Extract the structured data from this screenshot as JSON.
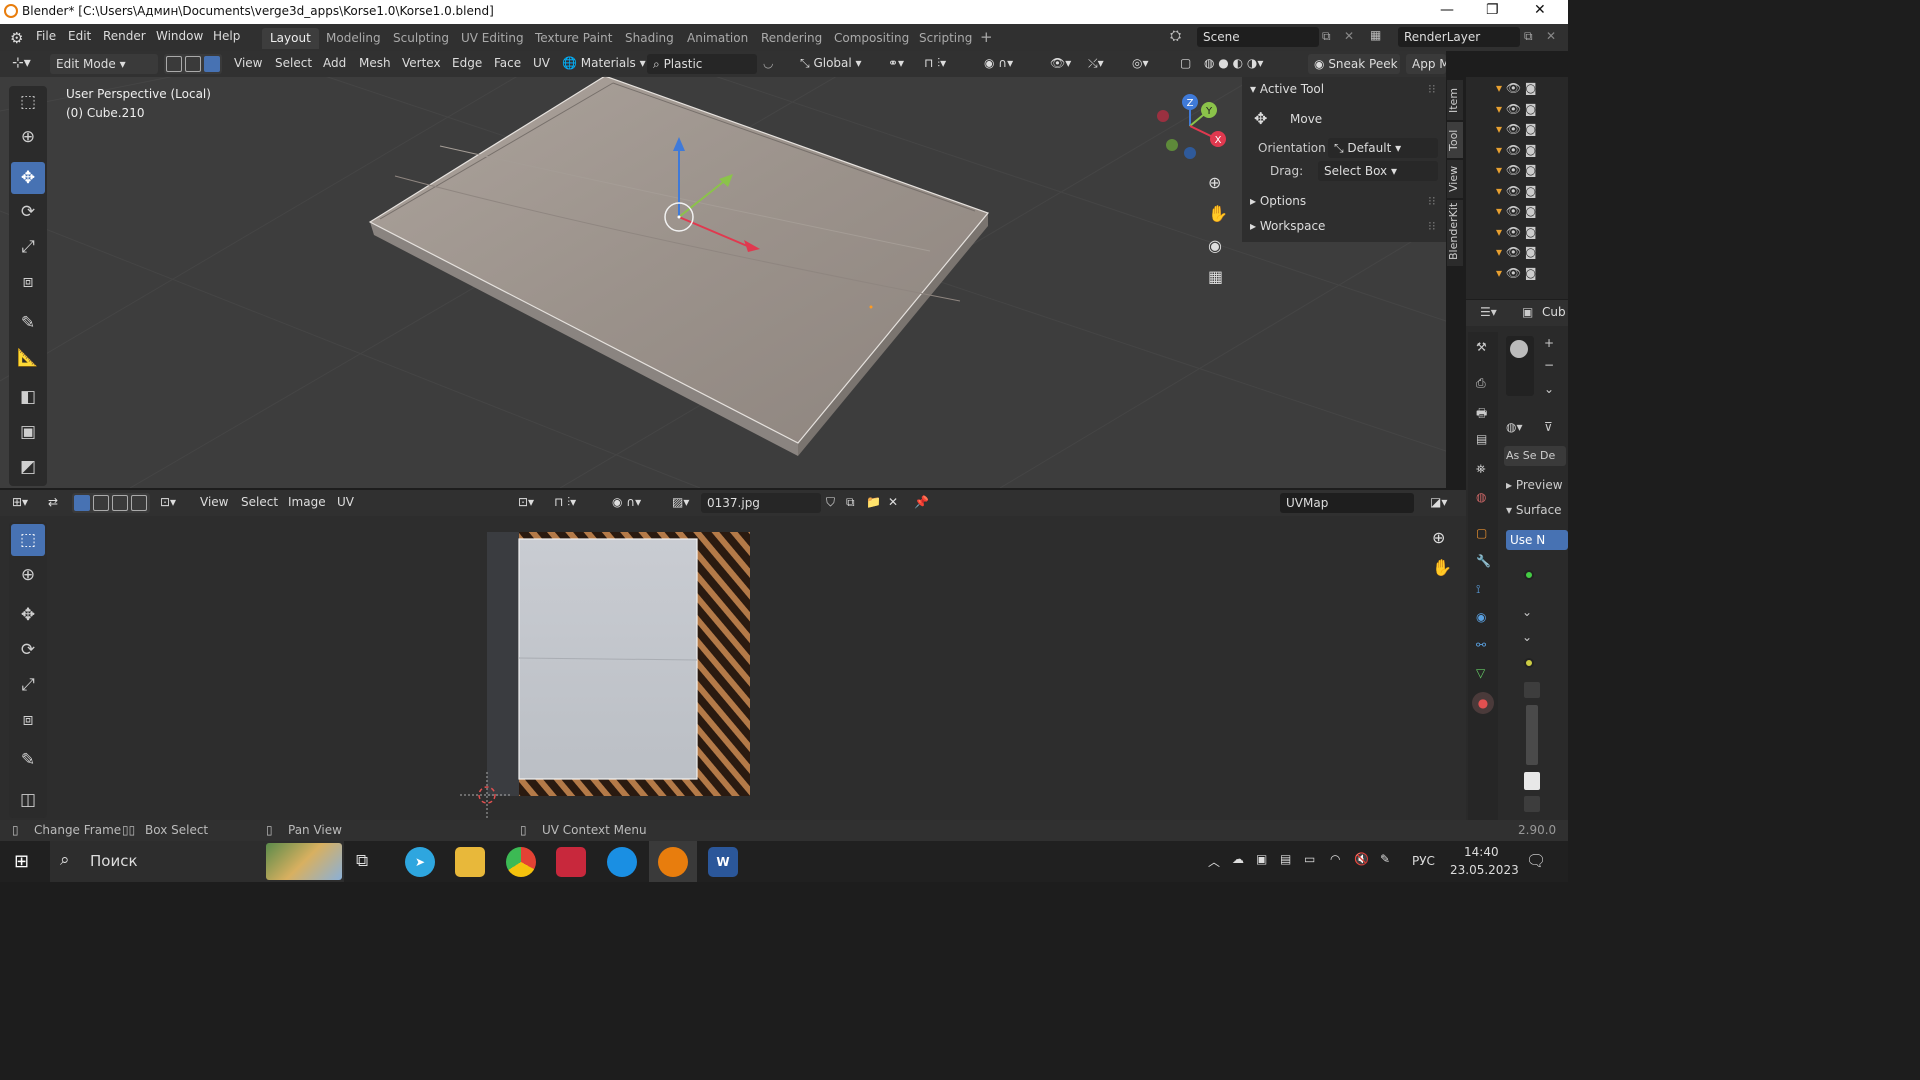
{
  "titlebar": {
    "title": "Blender* [C:\\Users\\Админ\\Documents\\verge3d_apps\\Korse1.0\\Korse1.0.blend]",
    "min": "—",
    "max": "❐",
    "close": "✕"
  },
  "menus": [
    "File",
    "Edit",
    "Render",
    "Window",
    "Help"
  ],
  "workspaces": [
    {
      "label": "Layout",
      "active": true
    },
    {
      "label": "Modeling"
    },
    {
      "label": "Sculpting"
    },
    {
      "label": "UV Editing"
    },
    {
      "label": "Texture Paint"
    },
    {
      "label": "Shading"
    },
    {
      "label": "Animation"
    },
    {
      "label": "Rendering"
    },
    {
      "label": "Compositing"
    },
    {
      "label": "Scripting"
    }
  ],
  "scene": {
    "name": "Scene",
    "render_layer": "RenderLayer"
  },
  "viewport_header": {
    "mode": "Edit Mode",
    "menus": [
      "View",
      "Select",
      "Add",
      "Mesh",
      "Vertex",
      "Edge",
      "Face",
      "UV"
    ],
    "materials": "Materials",
    "material_name": "Plastic",
    "orientation": "Global",
    "sneak_peek": "Sneak Peek",
    "app_manager": "App M"
  },
  "viewport_info": {
    "perspective": "User Perspective (Local)",
    "object": "(0) Cube.210"
  },
  "gizmo_axes": {
    "x": "X",
    "y": "Y",
    "z": "Z"
  },
  "npanel": {
    "active_tool": "Active Tool",
    "tool_name": "Move",
    "orientation_label": "Orientation",
    "orientation_value": "Default",
    "drag_label": "Drag:",
    "drag_value": "Select Box",
    "options": "Options",
    "workspace": "Workspace",
    "tabs": [
      "Item",
      "Tool",
      "View",
      "BlenderKit"
    ]
  },
  "properties": {
    "object_name": "Cub",
    "tabs3": [
      "As",
      "Se",
      "De"
    ],
    "preview": "Preview",
    "surface": "Surface",
    "use_nodes": "Use N"
  },
  "uv_header": {
    "menus": [
      "View",
      "Select",
      "Image",
      "UV"
    ],
    "image_name": "0137.jpg",
    "uvmap": "UVMap"
  },
  "statusbar": {
    "change_frame": "Change Frame",
    "box_select": "Box Select",
    "pan_view": "Pan View",
    "uv_context": "UV Context Menu",
    "version": "2.90.0"
  },
  "taskbar": {
    "search": "Поиск",
    "lang": "РУС",
    "time": "14:40",
    "date": "23.05.2023"
  },
  "colors": {
    "accent": "#4772b3",
    "header": "#303030",
    "viewport": "#3d3d3d",
    "x_axis": "#e0394f",
    "y_axis": "#8bc34a",
    "z_axis": "#3f7ad9"
  }
}
